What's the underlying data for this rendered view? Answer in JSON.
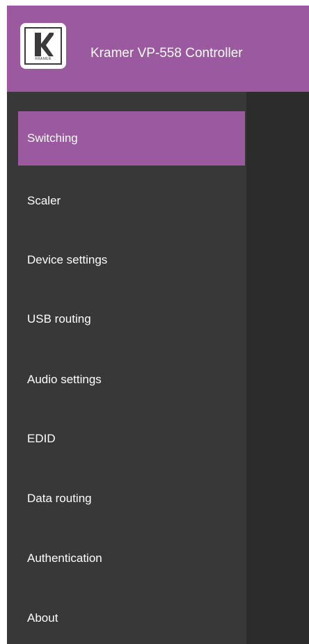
{
  "header": {
    "app_title": "Kramer VP-558 Controller",
    "brand_color": "#9b5a9f",
    "logo_icon": "kramer-k-logo"
  },
  "sidebar": {
    "background": "#383838",
    "items": [
      {
        "label": "Switching",
        "active": true
      },
      {
        "label": "Scaler",
        "active": false
      },
      {
        "label": "Device settings",
        "active": false
      },
      {
        "label": "USB routing",
        "active": false
      },
      {
        "label": "Audio settings",
        "active": false
      },
      {
        "label": "EDID",
        "active": false
      },
      {
        "label": "Data routing",
        "active": false
      },
      {
        "label": "Authentication",
        "active": false
      },
      {
        "label": "About",
        "active": false
      }
    ]
  }
}
